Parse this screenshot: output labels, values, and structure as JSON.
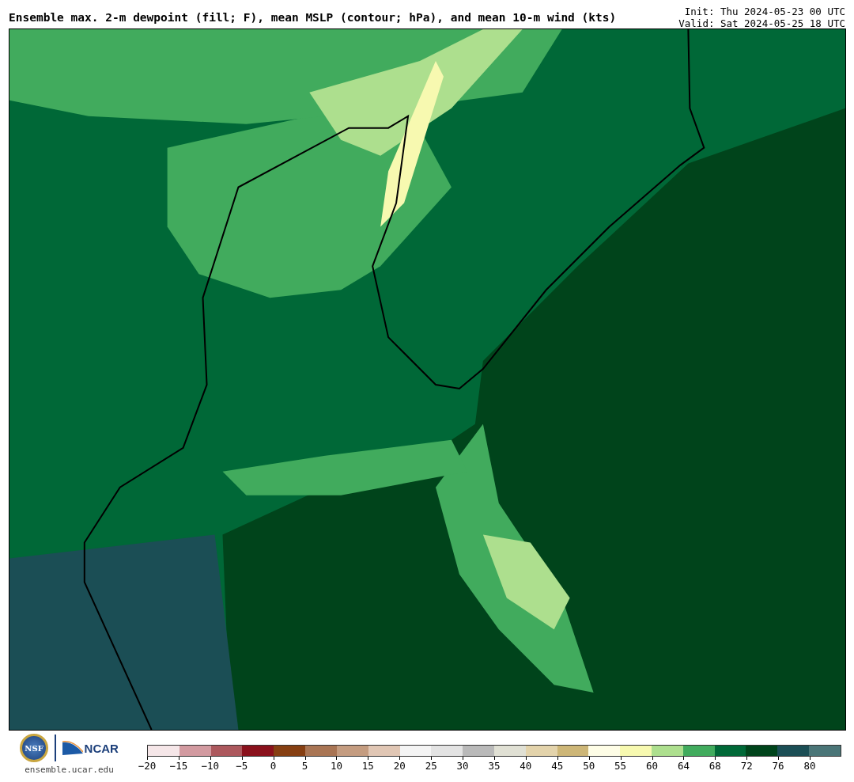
{
  "title": "Ensemble max. 2-m dewpoint (fill; F), mean MSLP (contour; hPa), and mean 10-m wind (kts)",
  "init": "Init: Thu 2024-05-23 00 UTC",
  "valid": "Valid: Sat 2024-05-25 18 UTC",
  "logos": {
    "nsf": "NSF",
    "ncar": "NCAR",
    "site": "ensemble.ucar.edu"
  },
  "colorbar": [
    {
      "label": "−20",
      "color": "#f5e6e8"
    },
    {
      "label": "−15",
      "color": "#d29aa0"
    },
    {
      "label": "−10",
      "color": "#ac585d"
    },
    {
      "label": "−5",
      "color": "#8a111c"
    },
    {
      "label": "0",
      "color": "#863f12"
    },
    {
      "label": "5",
      "color": "#a97554"
    },
    {
      "label": "10",
      "color": "#c49c80"
    },
    {
      "label": "15",
      "color": "#e0c6b4"
    },
    {
      "label": "20",
      "color": "#f4f4f4"
    },
    {
      "label": "25",
      "color": "#e3e3e3"
    },
    {
      "label": "30",
      "color": "#b9b9b9"
    },
    {
      "label": "35",
      "color": "#e0e0d4"
    },
    {
      "label": "40",
      "color": "#e3d3ab"
    },
    {
      "label": "45",
      "color": "#cdb677"
    },
    {
      "label": "50",
      "color": "#fefde6"
    },
    {
      "label": "55",
      "color": "#f7f9b0"
    },
    {
      "label": "60",
      "color": "#addf8e"
    },
    {
      "label": "64",
      "color": "#41ab5d"
    },
    {
      "label": "68",
      "color": "#006837"
    },
    {
      "label": "72",
      "color": "#00441b"
    },
    {
      "label": "76",
      "color": "#1b4e55"
    },
    {
      "label": "80",
      "color": "#4a7577"
    }
  ]
}
